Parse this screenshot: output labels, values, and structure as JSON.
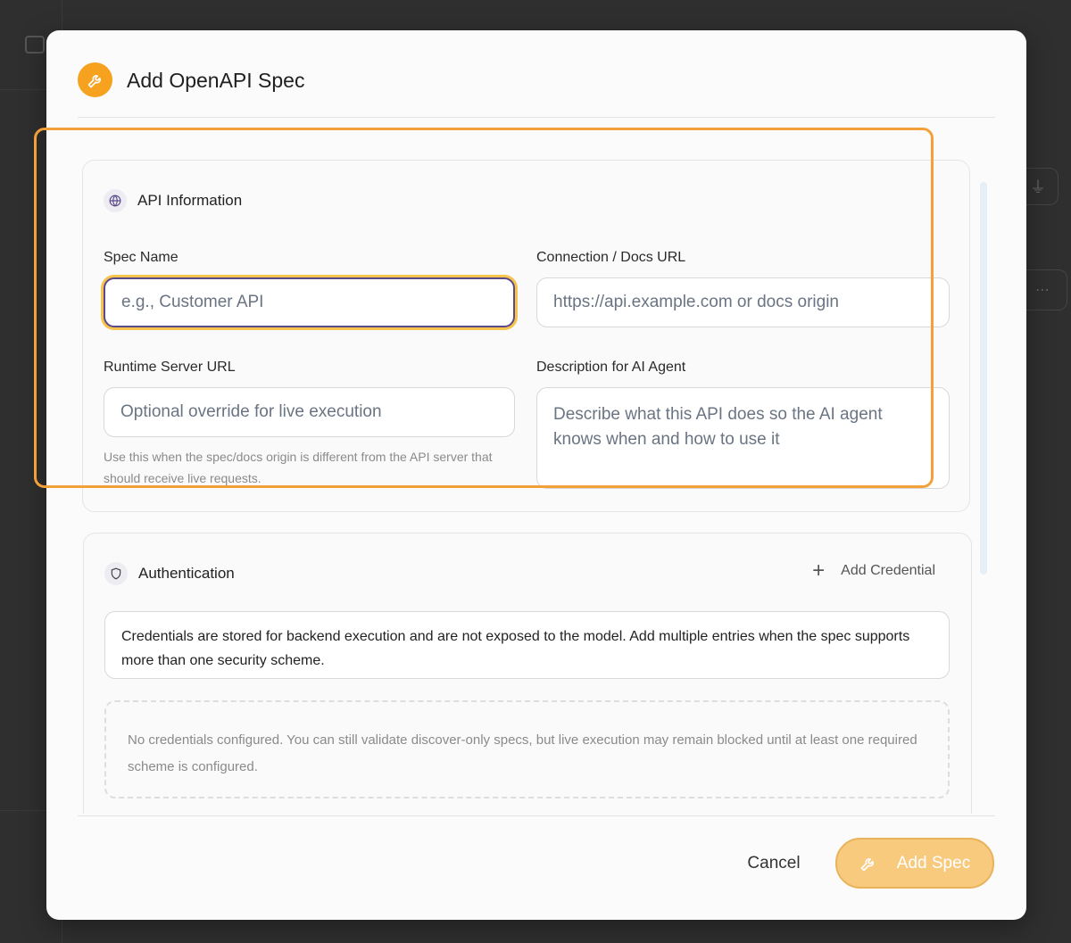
{
  "modal": {
    "title": "Add OpenAPI Spec",
    "header_icon": "wrench-icon"
  },
  "api_info": {
    "section_title": "API Information",
    "section_icon": "globe-icon",
    "spec_name": {
      "label": "Spec Name",
      "value": "",
      "placeholder": "e.g., Customer API"
    },
    "docs_url": {
      "label": "Connection / Docs URL",
      "value": "",
      "placeholder": "https://api.example.com or docs origin"
    },
    "runtime_url": {
      "label": "Runtime Server URL",
      "value": "",
      "placeholder": "Optional override for live execution",
      "hint": "Use this when the spec/docs origin is different from the API server that should receive live requests."
    },
    "description": {
      "label": "Description for AI Agent",
      "value": "",
      "placeholder": "Describe what this API does so the AI agent knows when and how to use it"
    }
  },
  "auth": {
    "section_title": "Authentication",
    "section_icon": "shield-icon",
    "add_credential_label": "Add Credential",
    "notice": "Credentials are stored for backend execution and are not exposed to the model. Add multiple entries when the spec supports more than one security scheme.",
    "empty_state": "No credentials configured. You can still validate discover-only specs, but live execution may remain blocked until at least one required scheme is configured."
  },
  "footer": {
    "cancel_label": "Cancel",
    "add_spec_label": "Add Spec"
  },
  "colors": {
    "accent": "#f6a21e",
    "focus_ring": "#f2a13a",
    "add_button_bg": "#f7ca7e"
  }
}
